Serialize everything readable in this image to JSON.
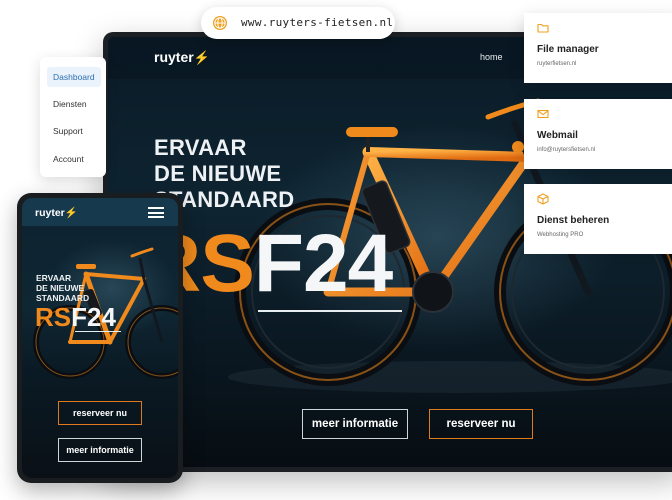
{
  "url_bar": {
    "url": "www.ruyters-fietsen.nl",
    "icon": "globe-icon"
  },
  "side_menu": {
    "items": [
      {
        "label": "Dashboard",
        "active": true
      },
      {
        "label": "Diensten",
        "active": false
      },
      {
        "label": "Support",
        "active": false
      },
      {
        "label": "Account",
        "active": false
      }
    ]
  },
  "desktop_site": {
    "logo": "ruyter",
    "nav_home": "home",
    "headline_lines": [
      "ERVAAR",
      "DE NIEUWE",
      "STANDAARD"
    ],
    "model_prefix": "RS",
    "model_suffix": "F24",
    "buttons": {
      "more_info": "meer informatie",
      "reserve": "reserveer nu"
    }
  },
  "mobile_site": {
    "logo": "ruyter",
    "headline_lines": [
      "ERVAAR",
      "DE NIEUWE",
      "STANDAARD"
    ],
    "model_prefix": "RS",
    "model_suffix": "F24",
    "buttons": {
      "reserve": "reserveer nu",
      "more_info": "meer informatie"
    }
  },
  "service_cards": [
    {
      "icon": "folder-icon",
      "title": "File manager",
      "subtitle": "ruyterfietsen.nl"
    },
    {
      "icon": "mail-icon",
      "title": "Webmail",
      "subtitle": "info@ruytersfietsen.nl"
    },
    {
      "icon": "box-icon",
      "title": "Dienst beheren",
      "subtitle": "Webhosting PRO"
    }
  ],
  "colors": {
    "accent_orange": "#f08a1c",
    "site_dark": "#0e2431",
    "active_menu_bg": "#eaf3fb",
    "active_menu_text": "#2c6fb0",
    "icon_orange": "#f0a020"
  }
}
